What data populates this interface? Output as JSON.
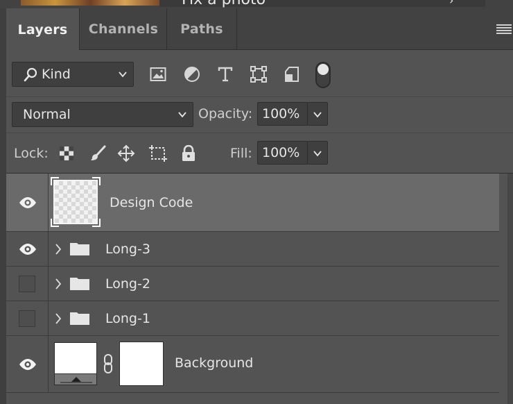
{
  "top_strip": {
    "text": "Fix a photo"
  },
  "tabs": [
    {
      "label": "Layers",
      "active": true
    },
    {
      "label": "Channels",
      "active": false
    },
    {
      "label": "Paths",
      "active": false
    }
  ],
  "filter": {
    "kind_label": "Kind",
    "buttons": [
      "image-filter-icon",
      "adjustment-filter-icon",
      "type-filter-icon",
      "shape-filter-icon",
      "smart-object-filter-icon"
    ]
  },
  "blend": {
    "mode": "Normal",
    "opacity_label": "Opacity:",
    "opacity_value": "100%"
  },
  "lock": {
    "label": "Lock:",
    "fill_label": "Fill:",
    "fill_value": "100%"
  },
  "layers": [
    {
      "name": "Design Code",
      "visible": true,
      "selected": true,
      "type": "pixel"
    },
    {
      "name": "Long-3",
      "visible": true,
      "selected": false,
      "type": "group"
    },
    {
      "name": "Long-2",
      "visible": false,
      "selected": false,
      "type": "group"
    },
    {
      "name": "Long-1",
      "visible": false,
      "selected": false,
      "type": "group"
    },
    {
      "name": "Background",
      "visible": true,
      "selected": false,
      "type": "masked"
    }
  ],
  "colors": {
    "panel": "#535353",
    "tabbar": "#424242",
    "selected_row": "#6a6a6a",
    "field": "#3f3f3f"
  }
}
